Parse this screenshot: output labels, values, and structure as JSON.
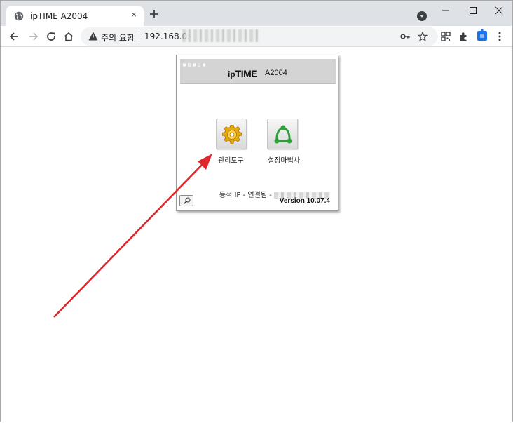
{
  "browser": {
    "tab": {
      "title": "ipTIME A2004",
      "close_glyph": "×",
      "favicon": "globe-icon"
    },
    "new_tab_icon": "plus-icon",
    "window_controls": [
      "minimize-icon",
      "maximize-icon",
      "close-icon"
    ],
    "toolbar": {
      "security_label": "주의 요함",
      "url": "192.168.0.",
      "icons": [
        "back-icon",
        "forward-icon",
        "reload-icon",
        "home-icon",
        "key-icon",
        "star-icon",
        "qr-icon",
        "extensions-icon",
        "extension-blue-icon",
        "menu-icon"
      ]
    }
  },
  "page": {
    "header": {
      "dots": "▪▫▪▫▪",
      "logo_prefix": "ip",
      "logo_main": "TIME",
      "model": "A2004"
    },
    "apps": [
      {
        "label": "관리도구",
        "icon": "gear-icon"
      },
      {
        "label": "설정마법사",
        "icon": "wizard-network-icon"
      }
    ],
    "status_text": "동적 IP - 연결됨 -",
    "version": "Version 10.07.4",
    "search_icon": "magnifier-icon"
  },
  "annotation": {
    "color": "#e0262b"
  }
}
